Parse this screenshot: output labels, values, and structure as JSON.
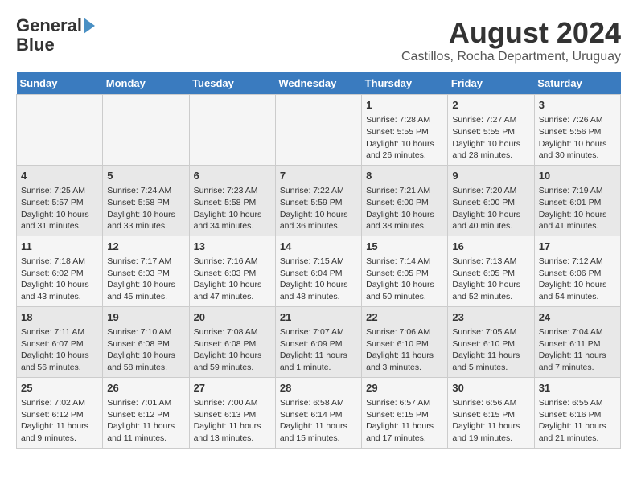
{
  "header": {
    "logo_line1": "General",
    "logo_line2": "Blue",
    "month": "August 2024",
    "location": "Castillos, Rocha Department, Uruguay"
  },
  "days_of_week": [
    "Sunday",
    "Monday",
    "Tuesday",
    "Wednesday",
    "Thursday",
    "Friday",
    "Saturday"
  ],
  "weeks": [
    [
      {
        "day": "",
        "info": ""
      },
      {
        "day": "",
        "info": ""
      },
      {
        "day": "",
        "info": ""
      },
      {
        "day": "",
        "info": ""
      },
      {
        "day": "1",
        "info": "Sunrise: 7:28 AM\nSunset: 5:55 PM\nDaylight: 10 hours\nand 26 minutes."
      },
      {
        "day": "2",
        "info": "Sunrise: 7:27 AM\nSunset: 5:55 PM\nDaylight: 10 hours\nand 28 minutes."
      },
      {
        "day": "3",
        "info": "Sunrise: 7:26 AM\nSunset: 5:56 PM\nDaylight: 10 hours\nand 30 minutes."
      }
    ],
    [
      {
        "day": "4",
        "info": "Sunrise: 7:25 AM\nSunset: 5:57 PM\nDaylight: 10 hours\nand 31 minutes."
      },
      {
        "day": "5",
        "info": "Sunrise: 7:24 AM\nSunset: 5:58 PM\nDaylight: 10 hours\nand 33 minutes."
      },
      {
        "day": "6",
        "info": "Sunrise: 7:23 AM\nSunset: 5:58 PM\nDaylight: 10 hours\nand 34 minutes."
      },
      {
        "day": "7",
        "info": "Sunrise: 7:22 AM\nSunset: 5:59 PM\nDaylight: 10 hours\nand 36 minutes."
      },
      {
        "day": "8",
        "info": "Sunrise: 7:21 AM\nSunset: 6:00 PM\nDaylight: 10 hours\nand 38 minutes."
      },
      {
        "day": "9",
        "info": "Sunrise: 7:20 AM\nSunset: 6:00 PM\nDaylight: 10 hours\nand 40 minutes."
      },
      {
        "day": "10",
        "info": "Sunrise: 7:19 AM\nSunset: 6:01 PM\nDaylight: 10 hours\nand 41 minutes."
      }
    ],
    [
      {
        "day": "11",
        "info": "Sunrise: 7:18 AM\nSunset: 6:02 PM\nDaylight: 10 hours\nand 43 minutes."
      },
      {
        "day": "12",
        "info": "Sunrise: 7:17 AM\nSunset: 6:03 PM\nDaylight: 10 hours\nand 45 minutes."
      },
      {
        "day": "13",
        "info": "Sunrise: 7:16 AM\nSunset: 6:03 PM\nDaylight: 10 hours\nand 47 minutes."
      },
      {
        "day": "14",
        "info": "Sunrise: 7:15 AM\nSunset: 6:04 PM\nDaylight: 10 hours\nand 48 minutes."
      },
      {
        "day": "15",
        "info": "Sunrise: 7:14 AM\nSunset: 6:05 PM\nDaylight: 10 hours\nand 50 minutes."
      },
      {
        "day": "16",
        "info": "Sunrise: 7:13 AM\nSunset: 6:05 PM\nDaylight: 10 hours\nand 52 minutes."
      },
      {
        "day": "17",
        "info": "Sunrise: 7:12 AM\nSunset: 6:06 PM\nDaylight: 10 hours\nand 54 minutes."
      }
    ],
    [
      {
        "day": "18",
        "info": "Sunrise: 7:11 AM\nSunset: 6:07 PM\nDaylight: 10 hours\nand 56 minutes."
      },
      {
        "day": "19",
        "info": "Sunrise: 7:10 AM\nSunset: 6:08 PM\nDaylight: 10 hours\nand 58 minutes."
      },
      {
        "day": "20",
        "info": "Sunrise: 7:08 AM\nSunset: 6:08 PM\nDaylight: 10 hours\nand 59 minutes."
      },
      {
        "day": "21",
        "info": "Sunrise: 7:07 AM\nSunset: 6:09 PM\nDaylight: 11 hours\nand 1 minute."
      },
      {
        "day": "22",
        "info": "Sunrise: 7:06 AM\nSunset: 6:10 PM\nDaylight: 11 hours\nand 3 minutes."
      },
      {
        "day": "23",
        "info": "Sunrise: 7:05 AM\nSunset: 6:10 PM\nDaylight: 11 hours\nand 5 minutes."
      },
      {
        "day": "24",
        "info": "Sunrise: 7:04 AM\nSunset: 6:11 PM\nDaylight: 11 hours\nand 7 minutes."
      }
    ],
    [
      {
        "day": "25",
        "info": "Sunrise: 7:02 AM\nSunset: 6:12 PM\nDaylight: 11 hours\nand 9 minutes."
      },
      {
        "day": "26",
        "info": "Sunrise: 7:01 AM\nSunset: 6:12 PM\nDaylight: 11 hours\nand 11 minutes."
      },
      {
        "day": "27",
        "info": "Sunrise: 7:00 AM\nSunset: 6:13 PM\nDaylight: 11 hours\nand 13 minutes."
      },
      {
        "day": "28",
        "info": "Sunrise: 6:58 AM\nSunset: 6:14 PM\nDaylight: 11 hours\nand 15 minutes."
      },
      {
        "day": "29",
        "info": "Sunrise: 6:57 AM\nSunset: 6:15 PM\nDaylight: 11 hours\nand 17 minutes."
      },
      {
        "day": "30",
        "info": "Sunrise: 6:56 AM\nSunset: 6:15 PM\nDaylight: 11 hours\nand 19 minutes."
      },
      {
        "day": "31",
        "info": "Sunrise: 6:55 AM\nSunset: 6:16 PM\nDaylight: 11 hours\nand 21 minutes."
      }
    ]
  ]
}
